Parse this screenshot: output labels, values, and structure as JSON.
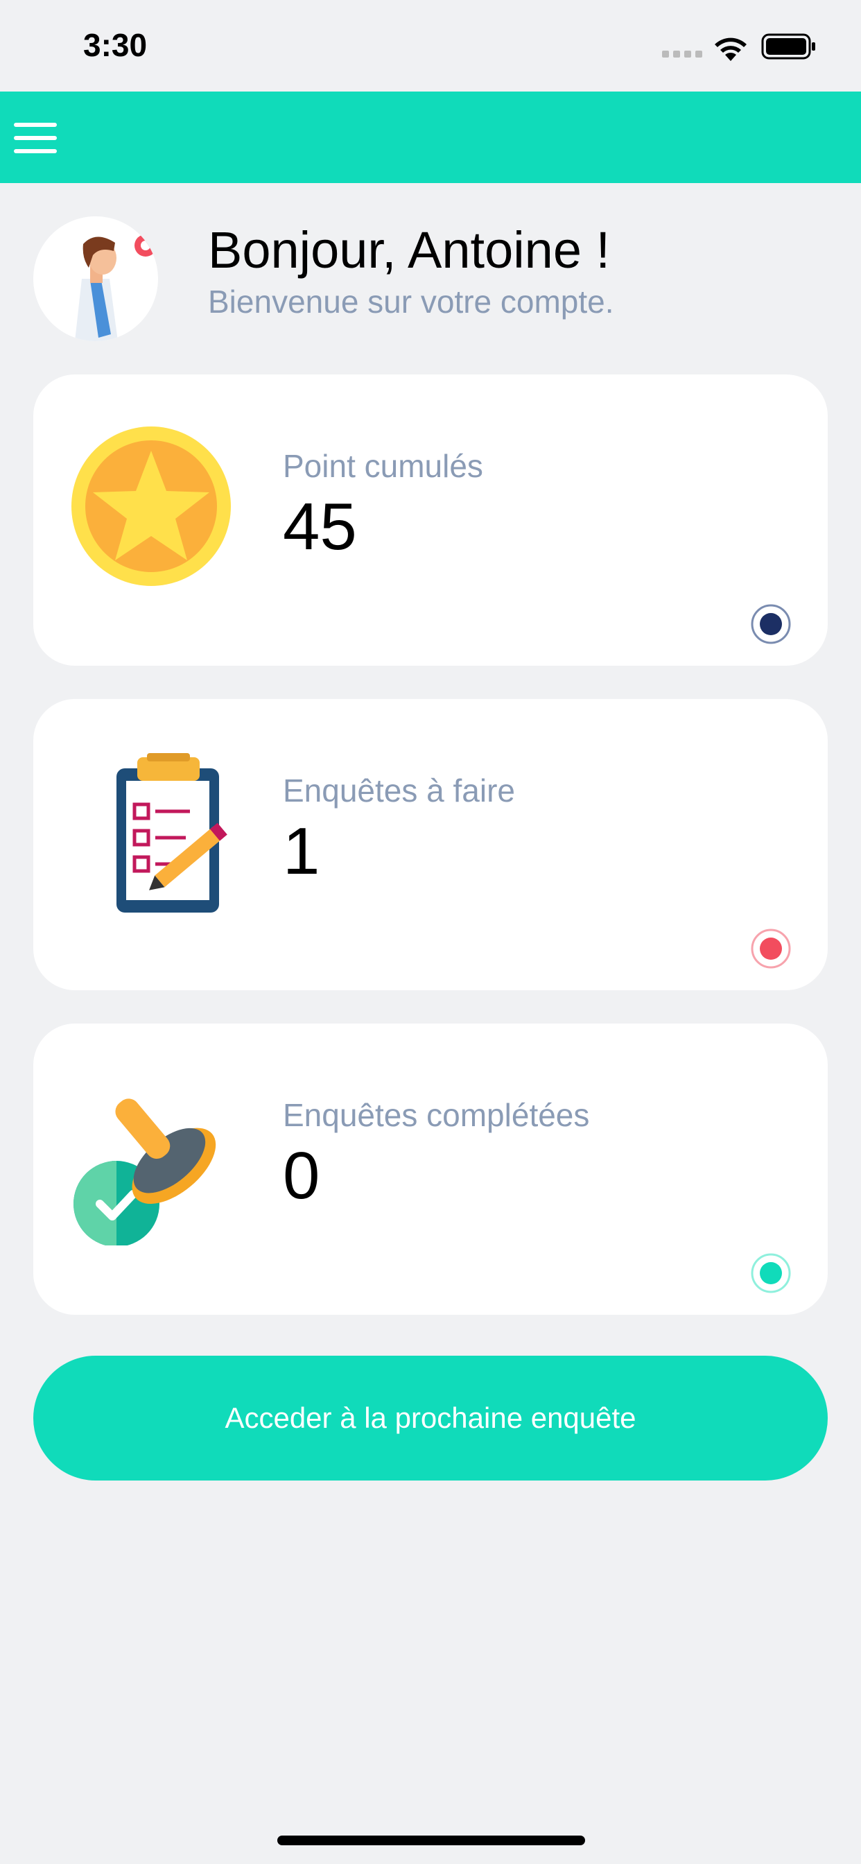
{
  "status_bar": {
    "time": "3:30"
  },
  "app_bar": {
    "menu_icon": "hamburger-menu-icon"
  },
  "greeting": {
    "title": "Bonjour, Antoine !",
    "subtitle": "Bienvenue sur votre compte.",
    "avatar_icon": "doctor-avatar-icon"
  },
  "cards": [
    {
      "icon": "star-coin-icon",
      "label": "Point cumulés",
      "value": "45",
      "dot_color": "#1c2f64"
    },
    {
      "icon": "clipboard-checklist-icon",
      "label": "Enquêtes à faire",
      "value": "1",
      "dot_color": "#f24d5e"
    },
    {
      "icon": "approval-stamp-icon",
      "label": "Enquêtes complétées",
      "value": "0",
      "dot_color": "#10dbba"
    }
  ],
  "cta": {
    "label": "Acceder à la prochaine enquête"
  },
  "colors": {
    "accent": "#10dbba",
    "muted_text": "#8a9bb5",
    "background": "#f0f1f3"
  }
}
